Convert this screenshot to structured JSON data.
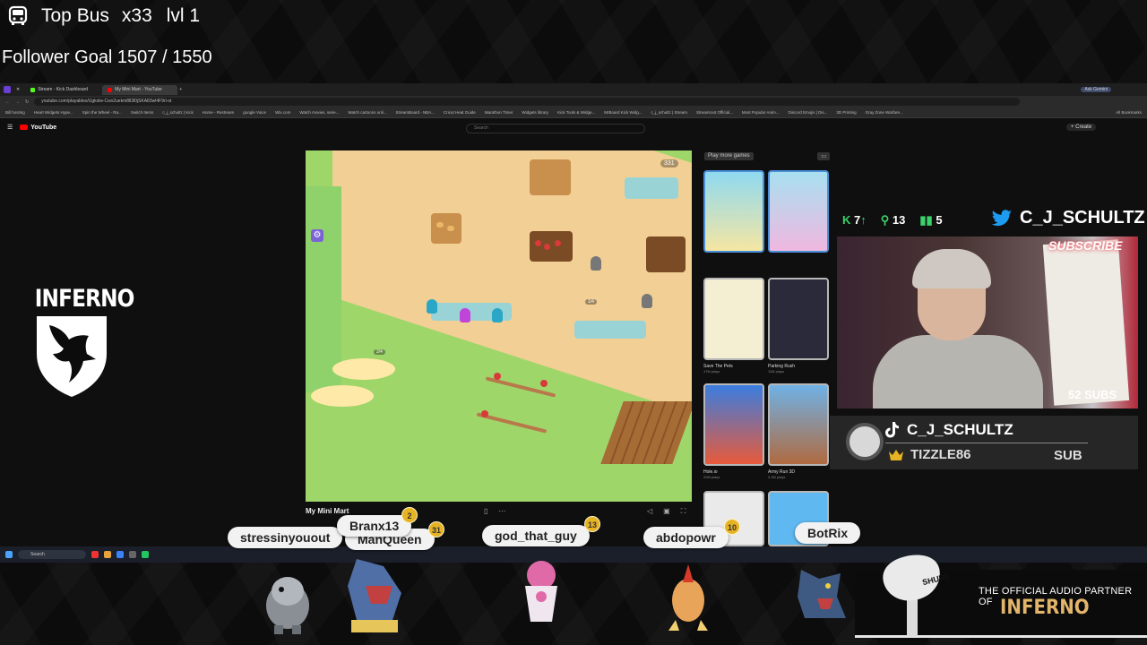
{
  "overlay": {
    "bus_title": "Top Bus",
    "bus_multiplier": "x33",
    "bus_level": "lvl 1",
    "follower_goal": "Follower Goal 1507 / 1550"
  },
  "browser": {
    "tabs": [
      {
        "label": "Stream - Kick Dashboard",
        "color": "#53fc18"
      },
      {
        "label": "My Mini Mart - YouTube",
        "color": "#ff0000"
      }
    ],
    "url": "youtube.com/playables/Ugkxlw-Cwx2uekm8ll3l0jSKA83wl4F9rl-st",
    "bookmarks": [
      "Bill hosting",
      "Heart Widgets Hype...",
      "Spin the Wheel - Ra...",
      "Switch Items",
      "c_j_schultz | Kick",
      "Home - Restream",
      "google Voice",
      "Wix.com",
      "Watch movies, serie...",
      "Watch cartoons onli...",
      "StreamBoard - NBA...",
      "Cricut Heat Guide",
      "Marathon Timer",
      "Widgets library",
      "Kick Tools & Widge...",
      "MrBoard Kick Widg...",
      "c_j_schultz | Stream",
      "Streamroot Official...",
      "Most Popular Anim...",
      "Discord Emojis | Dis...",
      "3D Printing",
      "Gray Zone Warfare...",
      "All Bookmarks"
    ],
    "ask_gemini": "Ask Gemini"
  },
  "youtube": {
    "logo": "YouTube",
    "search_placeholder": "Search",
    "create_label": "+ Create",
    "video_title": "My Mini Mart",
    "play_more": "Play more games",
    "coin_count": "331",
    "games": [
      {
        "title": "",
        "plays": ""
      },
      {
        "title": "",
        "plays": ""
      },
      {
        "title": "Save The Pets",
        "plays": "17M plays"
      },
      {
        "title": "Parking Rush",
        "plays": "11M plays"
      },
      {
        "title": "Hole.io",
        "plays": "20M plays"
      },
      {
        "title": "Army Run 3D",
        "plays": "2.2M plays"
      }
    ]
  },
  "stream": {
    "kicks": "7",
    "followers": "13",
    "subs_count": "5",
    "twitter_handle": "C_J_SCHULTZ",
    "subscribe_text": "SUBSCRIBE",
    "subs_badge": "52 SUBS",
    "tiktok_handle": "C_J_SCHULTZ",
    "latest_sub": "TIZZLE86",
    "latest_sub_label": "SUB"
  },
  "team": {
    "name": "INFERNO"
  },
  "taskbar": {
    "search_placeholder": "Search"
  },
  "chat": [
    {
      "name": "stressinyouout",
      "badge": ""
    },
    {
      "name": "Branx13",
      "badge": "2"
    },
    {
      "name": "ManQueen",
      "badge": "31"
    },
    {
      "name": "god_that_guy",
      "badge": "13"
    },
    {
      "name": "abdopowr",
      "badge": "10"
    },
    {
      "name": "BotRix",
      "badge": ""
    }
  ],
  "sponsor": {
    "tagline": "THE OFFICIAL AUDIO PARTNER OF",
    "brand": "INFERNO",
    "mic_brand": "SHURE"
  },
  "colors": {
    "accent_green": "#53fc18",
    "youtube_red": "#ff0000",
    "gold": "#e6b324"
  }
}
